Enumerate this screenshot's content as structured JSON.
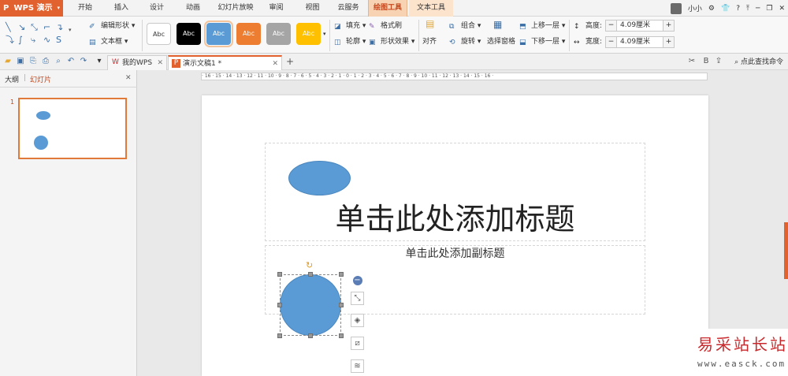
{
  "app": {
    "name": "WPS 演示",
    "logo": "P"
  },
  "menu_tabs": [
    "开始",
    "插入",
    "设计",
    "动画",
    "幻灯片放映",
    "审阅",
    "视图",
    "云服务",
    "绘图工具",
    "文本工具"
  ],
  "active_tab": "绘图工具",
  "user": {
    "name": "小小"
  },
  "ribbon": {
    "edit_shape": "编辑形状",
    "text_box": "文本框",
    "style_labels": [
      "Abc",
      "Abc",
      "Abc",
      "Abc",
      "Abc",
      "Abc"
    ],
    "style_colors": [
      "#ffffff",
      "#000000",
      "#5b9bd5",
      "#ed7d31",
      "#a5a5a5",
      "#ffc000"
    ],
    "fill": "填充",
    "format_painter": "格式刷",
    "outline": "轮廓",
    "shape_effects": "形状效果",
    "align": "对齐",
    "group": "组合",
    "rotate": "旋转",
    "selection_pane": "选择窗格",
    "bring_forward": "上移一层",
    "send_backward": "下移一层",
    "height_label": "高度:",
    "height_value": "4.09厘米",
    "width_label": "宽度:",
    "width_value": "4.09厘米",
    "minus": "−",
    "plus": "+"
  },
  "doc_tabs": [
    {
      "label": "我的WPS",
      "icon": "W"
    },
    {
      "label": "演示文稿1 *",
      "icon": "P"
    }
  ],
  "new_tab": "+",
  "search_command": "点此查找命令",
  "left_pane": {
    "tab_outline": "大纲",
    "tab_slides": "幻灯片",
    "slide_number": "1",
    "close": "✕"
  },
  "ruler_text": "· 16 · 15 · 14 · 13 · 12 · 11 · 10 · 9 · 8 · 7 · 6 · 5 · 4 · 3 · 2 · 1 · 0 · 1 · 2 · 3 · 4 · 5 · 6 · 7 · 8 · 9 · 10 · 11 · 12 · 13 · 14 · 15 · 16 ·",
  "slide": {
    "title_placeholder": "单击此处添加标题",
    "subtitle_placeholder": "单击此处添加副标题"
  },
  "watermark": {
    "title": "易采站长站",
    "url": "www.easck.com"
  }
}
